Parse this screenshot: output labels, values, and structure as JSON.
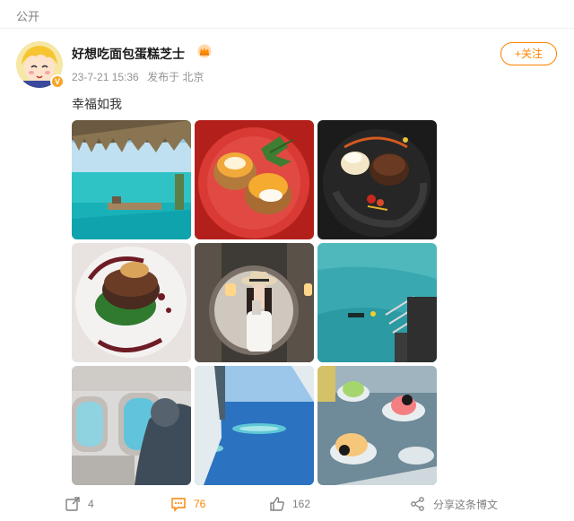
{
  "header": {
    "visibility": "公开"
  },
  "post": {
    "username": "好想吃面包蛋糕芝士",
    "timestamp": "23-7-21 15:36",
    "source": "发布于 北京",
    "text": "幸福如我",
    "follow_label": "+关注",
    "verified_badge": "V"
  },
  "photos": [
    "infinity-pool-ocean-view",
    "eggs-benedict-red-plate",
    "chocolate-lava-cake-ice-cream",
    "steak-with-foie-gras",
    "mirror-selfie-with-hat",
    "overwater-villa-snorkeler",
    "seaplane-window-passenger",
    "aerial-atoll-view",
    "ice-cream-coupes-platter"
  ],
  "actions": {
    "repost_count": "4",
    "comment_count": "76",
    "like_count": "162",
    "share_label": "分享这条博文"
  },
  "colors": {
    "accent": "#ff8200",
    "muted": "#808080",
    "gold": "#f5a623"
  }
}
